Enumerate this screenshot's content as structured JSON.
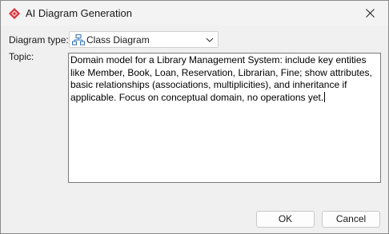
{
  "window": {
    "title": "AI Diagram Generation",
    "icon": "app-diamond-icon",
    "accent_color": "#d8323c"
  },
  "form": {
    "diagram_type_label": "Diagram type:",
    "diagram_type_value": "Class Diagram",
    "diagram_type_icon": "class-diagram-icon",
    "topic_label": "Topic:",
    "topic_value": "Domain model for a Library Management System: include key entities like Member, Book, Loan, Reservation, Librarian, Fine; show attributes, basic relationships (associations, multiplicities), and inheritance if applicable. Focus on conceptual domain, no operations yet."
  },
  "buttons": {
    "ok_label": "OK",
    "cancel_label": "Cancel"
  }
}
